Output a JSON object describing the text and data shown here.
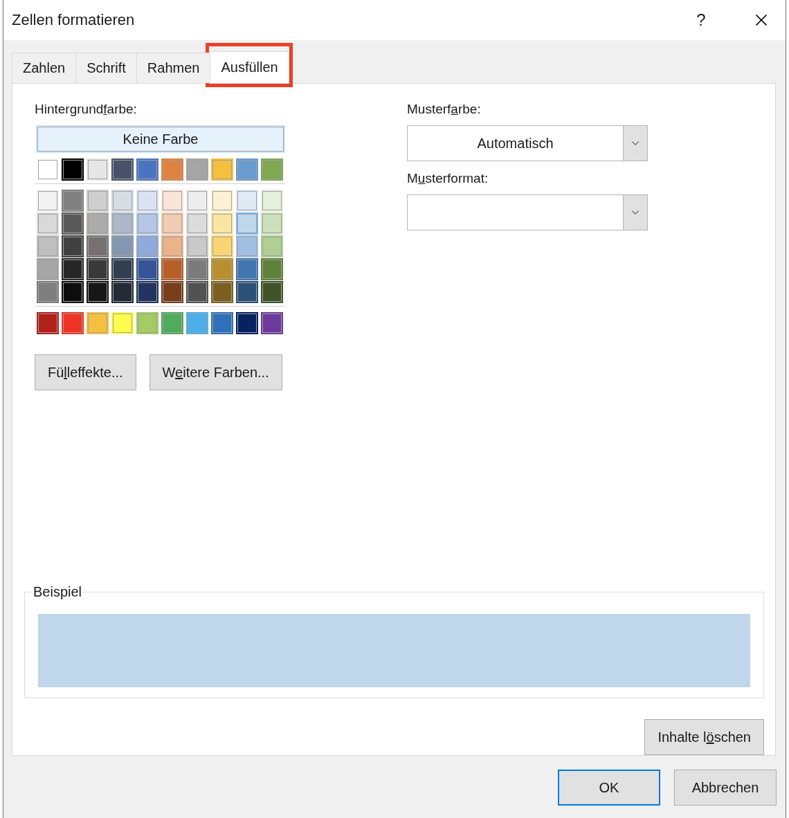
{
  "window": {
    "title": "Zellen formatieren",
    "help": "?"
  },
  "tabs": [
    {
      "label": "Zahlen",
      "selected": false,
      "highlighted": false
    },
    {
      "label": "Schrift",
      "selected": false,
      "highlighted": false
    },
    {
      "label": "Rahmen",
      "selected": false,
      "highlighted": false
    },
    {
      "label": "Ausfüllen",
      "selected": true,
      "highlighted": true
    }
  ],
  "background_color": {
    "label": {
      "before": "Hintergrund",
      "key": "f",
      "after": "arbe:"
    },
    "no_color": "Keine Farbe",
    "sections": [
      [
        [
          {
            "color": "#ffffff",
            "selected": false
          },
          {
            "color": "#000000",
            "selected": false
          },
          {
            "color": "#e6e6e6",
            "selected": false
          },
          {
            "color": "#46536a",
            "selected": false
          },
          {
            "color": "#4a74c0",
            "selected": false
          },
          {
            "color": "#e0823f",
            "selected": false
          },
          {
            "color": "#a5a5a5",
            "selected": false
          },
          {
            "color": "#f5bf3f",
            "selected": false
          },
          {
            "color": "#689cd0",
            "selected": false
          },
          {
            "color": "#7ea852",
            "selected": false
          }
        ]
      ],
      [
        [
          {
            "color": "#f2f2f2",
            "selected": false
          },
          {
            "color": "#808080",
            "selected": false
          },
          {
            "color": "#d0cece",
            "selected": false
          },
          {
            "color": "#d6dce4",
            "selected": false
          },
          {
            "color": "#dae3f3",
            "selected": false
          },
          {
            "color": "#f8e4d9",
            "selected": false
          },
          {
            "color": "#ededed",
            "selected": false
          },
          {
            "color": "#fcf1d2",
            "selected": false
          },
          {
            "color": "#dfeaf5",
            "selected": false
          },
          {
            "color": "#e4efdc",
            "selected": false
          }
        ],
        [
          {
            "color": "#d9d9d9",
            "selected": false
          },
          {
            "color": "#595959",
            "selected": false
          },
          {
            "color": "#aeabab",
            "selected": false
          },
          {
            "color": "#adb9ca",
            "selected": false
          },
          {
            "color": "#b4c7e7",
            "selected": false
          },
          {
            "color": "#f1cdb2",
            "selected": false
          },
          {
            "color": "#dbdbdb",
            "selected": false
          },
          {
            "color": "#fbe5a2",
            "selected": false
          },
          {
            "color": "#c0d6eb",
            "selected": true
          },
          {
            "color": "#cde0bc",
            "selected": false
          }
        ],
        [
          {
            "color": "#bfbfbf",
            "selected": false
          },
          {
            "color": "#404040",
            "selected": false
          },
          {
            "color": "#757171",
            "selected": false
          },
          {
            "color": "#8497b0",
            "selected": false
          },
          {
            "color": "#8faadc",
            "selected": false
          },
          {
            "color": "#ecb38a",
            "selected": false
          },
          {
            "color": "#c9c9c9",
            "selected": false
          },
          {
            "color": "#f9d673",
            "selected": false
          },
          {
            "color": "#a0c1e4",
            "selected": false
          },
          {
            "color": "#b0cf93",
            "selected": false
          }
        ],
        [
          {
            "color": "#a6a6a6",
            "selected": false
          },
          {
            "color": "#262626",
            "selected": false
          },
          {
            "color": "#3a3838",
            "selected": false
          },
          {
            "color": "#333f50",
            "selected": false
          },
          {
            "color": "#365597",
            "selected": false
          },
          {
            "color": "#b85f28",
            "selected": false
          },
          {
            "color": "#7b7b7b",
            "selected": false
          },
          {
            "color": "#b88e2f",
            "selected": false
          },
          {
            "color": "#4176b1",
            "selected": false
          },
          {
            "color": "#5e813c",
            "selected": false
          }
        ],
        [
          {
            "color": "#7f7f7f",
            "selected": false
          },
          {
            "color": "#0d0d0d",
            "selected": false
          },
          {
            "color": "#171717",
            "selected": false
          },
          {
            "color": "#222a35",
            "selected": false
          },
          {
            "color": "#223560",
            "selected": false
          },
          {
            "color": "#7a3e1a",
            "selected": false
          },
          {
            "color": "#525252",
            "selected": false
          },
          {
            "color": "#7c6020",
            "selected": false
          },
          {
            "color": "#2c5179",
            "selected": false
          },
          {
            "color": "#3e5428",
            "selected": false
          }
        ]
      ],
      [
        [
          {
            "color": "#b0211a",
            "selected": false
          },
          {
            "color": "#ee3424",
            "selected": false
          },
          {
            "color": "#f5bf42",
            "selected": false
          },
          {
            "color": "#fffc4d",
            "selected": false
          },
          {
            "color": "#a2cd64",
            "selected": false
          },
          {
            "color": "#50ab5d",
            "selected": false
          },
          {
            "color": "#4daee9",
            "selected": false
          },
          {
            "color": "#2e70b9",
            "selected": false
          },
          {
            "color": "#062360",
            "selected": false
          },
          {
            "color": "#6c3a9b",
            "selected": false
          }
        ]
      ]
    ],
    "buttons": [
      {
        "before": "Fü",
        "key": "l",
        "after": "leffekte..."
      },
      {
        "before": "W",
        "key": "e",
        "after": "itere Farben..."
      }
    ]
  },
  "pattern_color": {
    "label": {
      "before": "Musterf",
      "key": "a",
      "after": "rbe:"
    },
    "value": "Automatisch"
  },
  "pattern_style": {
    "label": {
      "before": "M",
      "key": "u",
      "after": "sterformat:"
    }
  },
  "sample": {
    "label": "Beispiel"
  },
  "clear_button": {
    "before": "Inhalte l",
    "key": "ö",
    "after": "schen"
  },
  "footer_buttons": [
    {
      "label": "OK",
      "kind": "default"
    },
    {
      "label": "Abbrechen",
      "kind": "normal"
    }
  ]
}
